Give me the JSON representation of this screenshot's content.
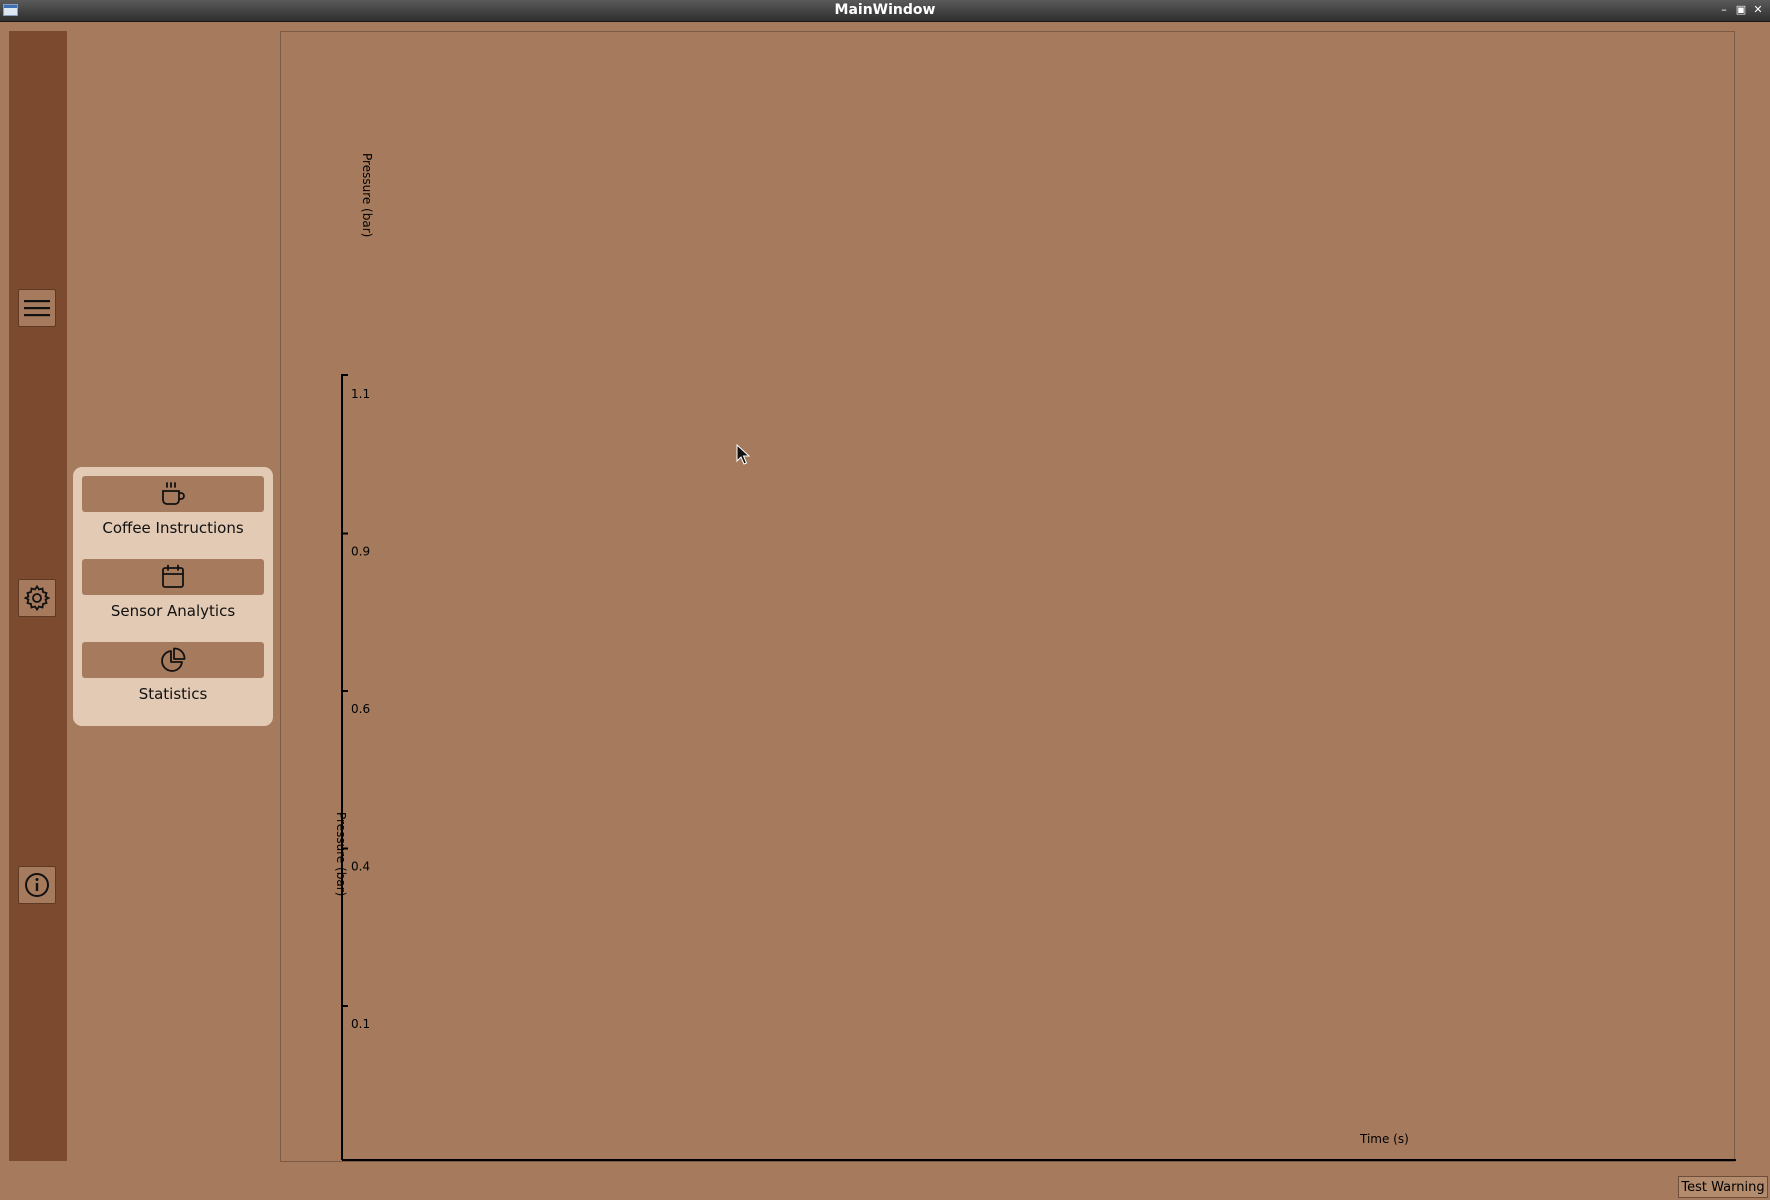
{
  "window": {
    "title": "MainWindow",
    "controls": [
      "minimize-icon",
      "maximize-icon",
      "close-icon"
    ]
  },
  "sidebar": {
    "buttons": [
      {
        "icon": "hamburger-menu-icon"
      },
      {
        "icon": "gear-icon"
      },
      {
        "icon": "info-icon"
      }
    ]
  },
  "menu": {
    "items": [
      {
        "label": "Coffee Instructions",
        "icon": "coffee-cup-icon"
      },
      {
        "label": "Sensor Analytics",
        "icon": "calendar-icon"
      },
      {
        "label": "Statistics",
        "icon": "pie-chart-icon"
      }
    ]
  },
  "chart_data": {
    "type": "line",
    "title": "",
    "ylabel": "Pressure (bar)",
    "ylabel_overlay": "Pressure (bar)",
    "xlabel": "Time (s)",
    "y_ticks": [
      "1.1",
      "0.9",
      "0.6",
      "0.4",
      "0.1"
    ],
    "y_tick_values": [
      1.1,
      0.9,
      0.6,
      0.4,
      0.1
    ],
    "series": [],
    "grid": false
  },
  "footer": {
    "test_warning_label": "Test Warning"
  },
  "colors": {
    "background": "#a67b5d",
    "rail": "#7b4a2f",
    "menu_panel": "#e2cab4"
  }
}
